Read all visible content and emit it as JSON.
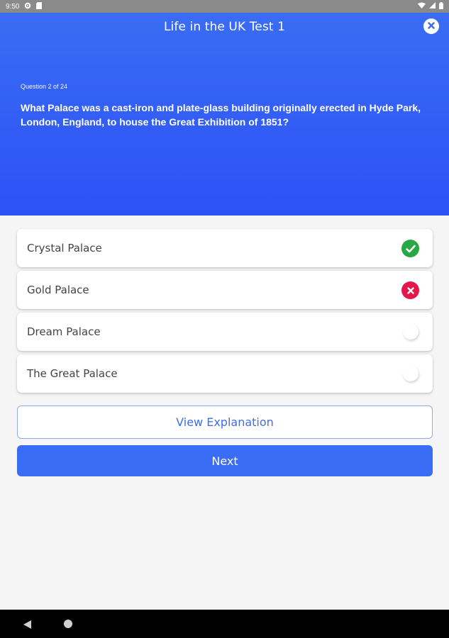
{
  "status_bar": {
    "time": "9:50"
  },
  "header": {
    "title": "Life in the UK Test 1",
    "question_number": "Question 2 of 24",
    "question_text": "What Palace was a cast-iron and plate-glass building originally erected in Hyde Park, London, England, to house the Great Exhibition of 1851?"
  },
  "options": [
    {
      "label": "Crystal Palace",
      "state": "correct"
    },
    {
      "label": "Gold Palace",
      "state": "wrong"
    },
    {
      "label": "Dream Palace",
      "state": "unselected"
    },
    {
      "label": "The Great Palace",
      "state": "unselected"
    }
  ],
  "buttons": {
    "explain_label": "View Explanation",
    "next_label": "Next"
  },
  "colors": {
    "header": "#3a6cf4",
    "correct": "#27a844",
    "wrong": "#e5174a",
    "primary_button": "#3a6cf6"
  }
}
